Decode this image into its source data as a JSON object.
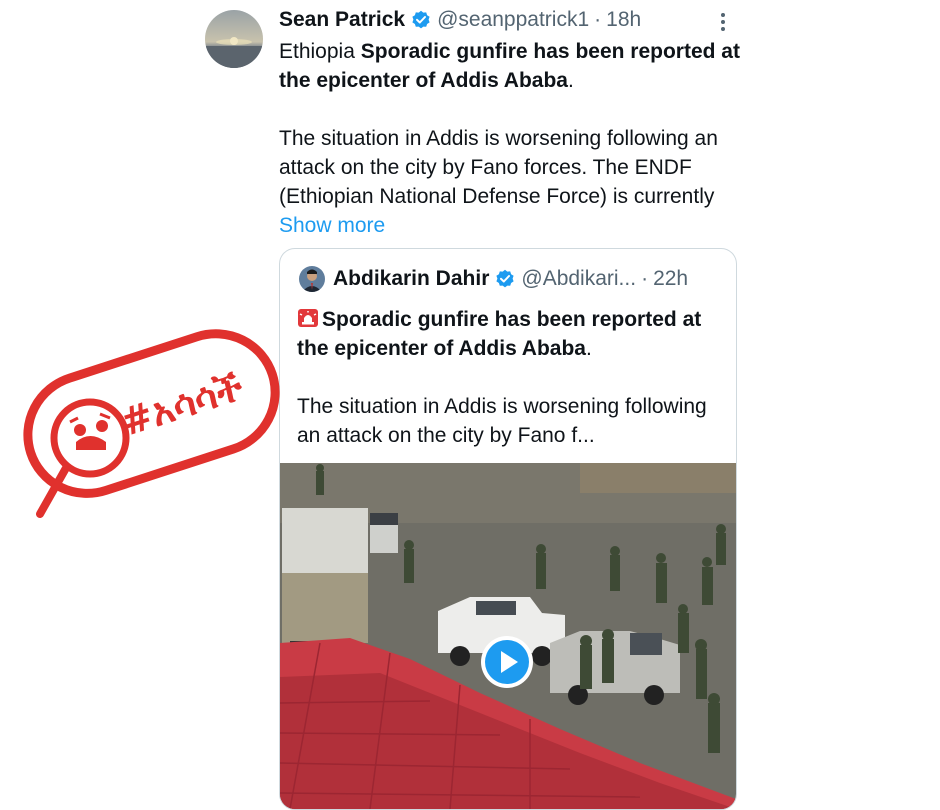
{
  "tweet": {
    "author_name": "Sean Patrick",
    "handle": "@seanppatrick1",
    "separator": "·",
    "time": "18h",
    "text_prefix": "Ethiopia ",
    "text_bold": "Sporadic gunfire has been reported at the epicenter of Addis Ababa",
    "text_period": ".",
    "paragraph2": "The situation in Addis is worsening following an attack on the city by Fano forces. The ENDF (Ethiopian National Defense Force) is currently ",
    "show_more": "Show more"
  },
  "quoted_tweet": {
    "author_name": "Abdikarin Dahir",
    "handle": "@Abdikari...",
    "separator": "·",
    "time": "22h",
    "text_bold": "Sporadic gunfire has been reported at the epicenter of Addis Ababa",
    "text_period": ".",
    "paragraph2": "The situation in Addis is worsening following an attack on the city by Fano f..."
  },
  "stamp": {
    "text": "#አሳሳች"
  },
  "icons": {
    "verified": "verified-badge-icon",
    "more": "more-vertical-icon",
    "play": "play-icon",
    "siren": "siren-emoji-icon",
    "stamp_logo": "magnifier-face-icon"
  },
  "colors": {
    "verified": "#1d9bf0",
    "link": "#1d9bf0",
    "stamp_red": "#e0312d",
    "muted": "#536471"
  }
}
